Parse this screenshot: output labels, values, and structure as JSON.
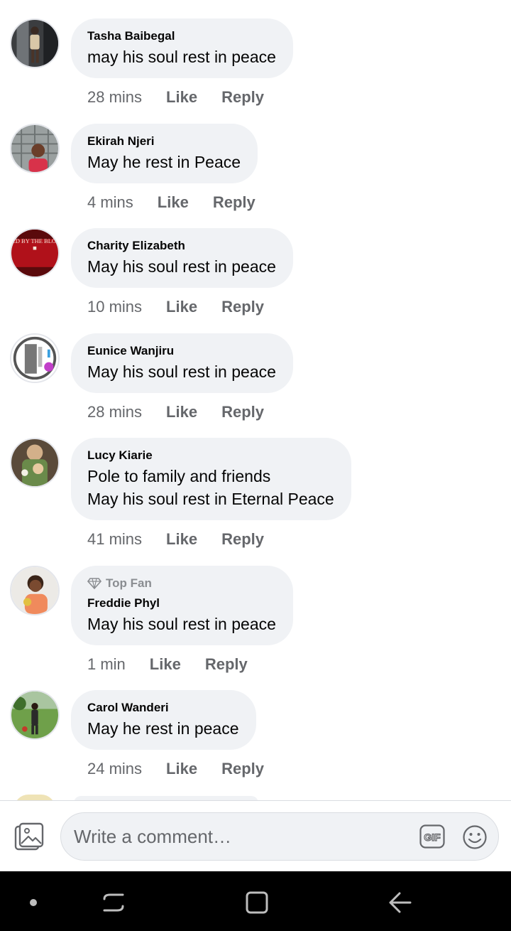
{
  "comments": [
    {
      "author": "Tasha Baibegal",
      "text": "may his soul rest in peace",
      "time": "28 mins",
      "like": "Like",
      "reply": "Reply",
      "top_fan": ""
    },
    {
      "author": "Ekirah Njeri",
      "text": "May he rest in Peace",
      "time": "4 mins",
      "like": "Like",
      "reply": "Reply",
      "top_fan": ""
    },
    {
      "author": "Charity Elizabeth",
      "text": "May his soul rest in peace",
      "time": "10 mins",
      "like": "Like",
      "reply": "Reply",
      "top_fan": "",
      "avatar_text": "I AM COVERED BY THE BLOOD OF JESUS"
    },
    {
      "author": "Eunice Wanjiru",
      "text": "May his soul rest in peace",
      "time": "28 mins",
      "like": "Like",
      "reply": "Reply",
      "top_fan": ""
    },
    {
      "author": "Lucy Kiarie",
      "text": "Pole to family and friends\nMay his soul rest in Eternal Peace",
      "time": "41 mins",
      "like": "Like",
      "reply": "Reply",
      "top_fan": ""
    },
    {
      "author": "Freddie Phyl",
      "text": "May his soul rest in peace",
      "time": "1 min",
      "like": "Like",
      "reply": "Reply",
      "top_fan": "Top Fan"
    },
    {
      "author": "Carol Wanderi",
      "text": "May he rest in peace",
      "time": "24 mins",
      "like": "Like",
      "reply": "Reply",
      "top_fan": ""
    }
  ],
  "composer": {
    "placeholder": "Write a comment…",
    "photo_icon": "photo-icon",
    "gif_icon": "gif-icon",
    "emoji_icon": "emoji-icon"
  },
  "navbar": {
    "icons": [
      "nav-dot-icon",
      "recent-apps-icon",
      "home-icon",
      "back-icon"
    ]
  },
  "colors": {
    "bubble": "#f0f2f5",
    "meta_text": "#65676b",
    "name_text": "#050505",
    "navbar": "#000000"
  }
}
